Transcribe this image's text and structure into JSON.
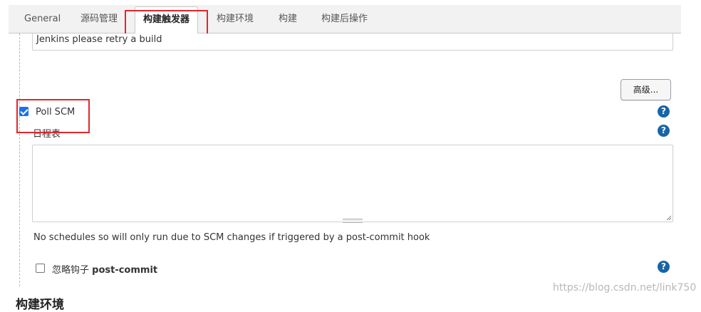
{
  "tabs": [
    {
      "label": "General"
    },
    {
      "label": "源码管理"
    },
    {
      "label": "构建触发器",
      "active": true
    },
    {
      "label": "构建环境"
    },
    {
      "label": "构建"
    },
    {
      "label": "构建后操作"
    }
  ],
  "retry_field": {
    "value": "Jenkins please retry a build"
  },
  "advanced_button": {
    "label": "高级..."
  },
  "poll_scm": {
    "label": "Poll SCM",
    "checked": true
  },
  "schedule": {
    "label": "日程表",
    "value": ""
  },
  "schedule_hint": "No schedules so will only run due to SCM changes if triggered by a post-commit hook",
  "ignore_post_commit": {
    "label_prefix": "忽略钩子 ",
    "label_bold": "post-commit",
    "checked": false
  },
  "next_section_title": "构建环境",
  "help_icon_glyph": "?",
  "watermark": "https://blog.csdn.net/link750",
  "colors": {
    "accent": "#1a73e8",
    "help": "#1765a8",
    "highlight": "#e3262a"
  }
}
